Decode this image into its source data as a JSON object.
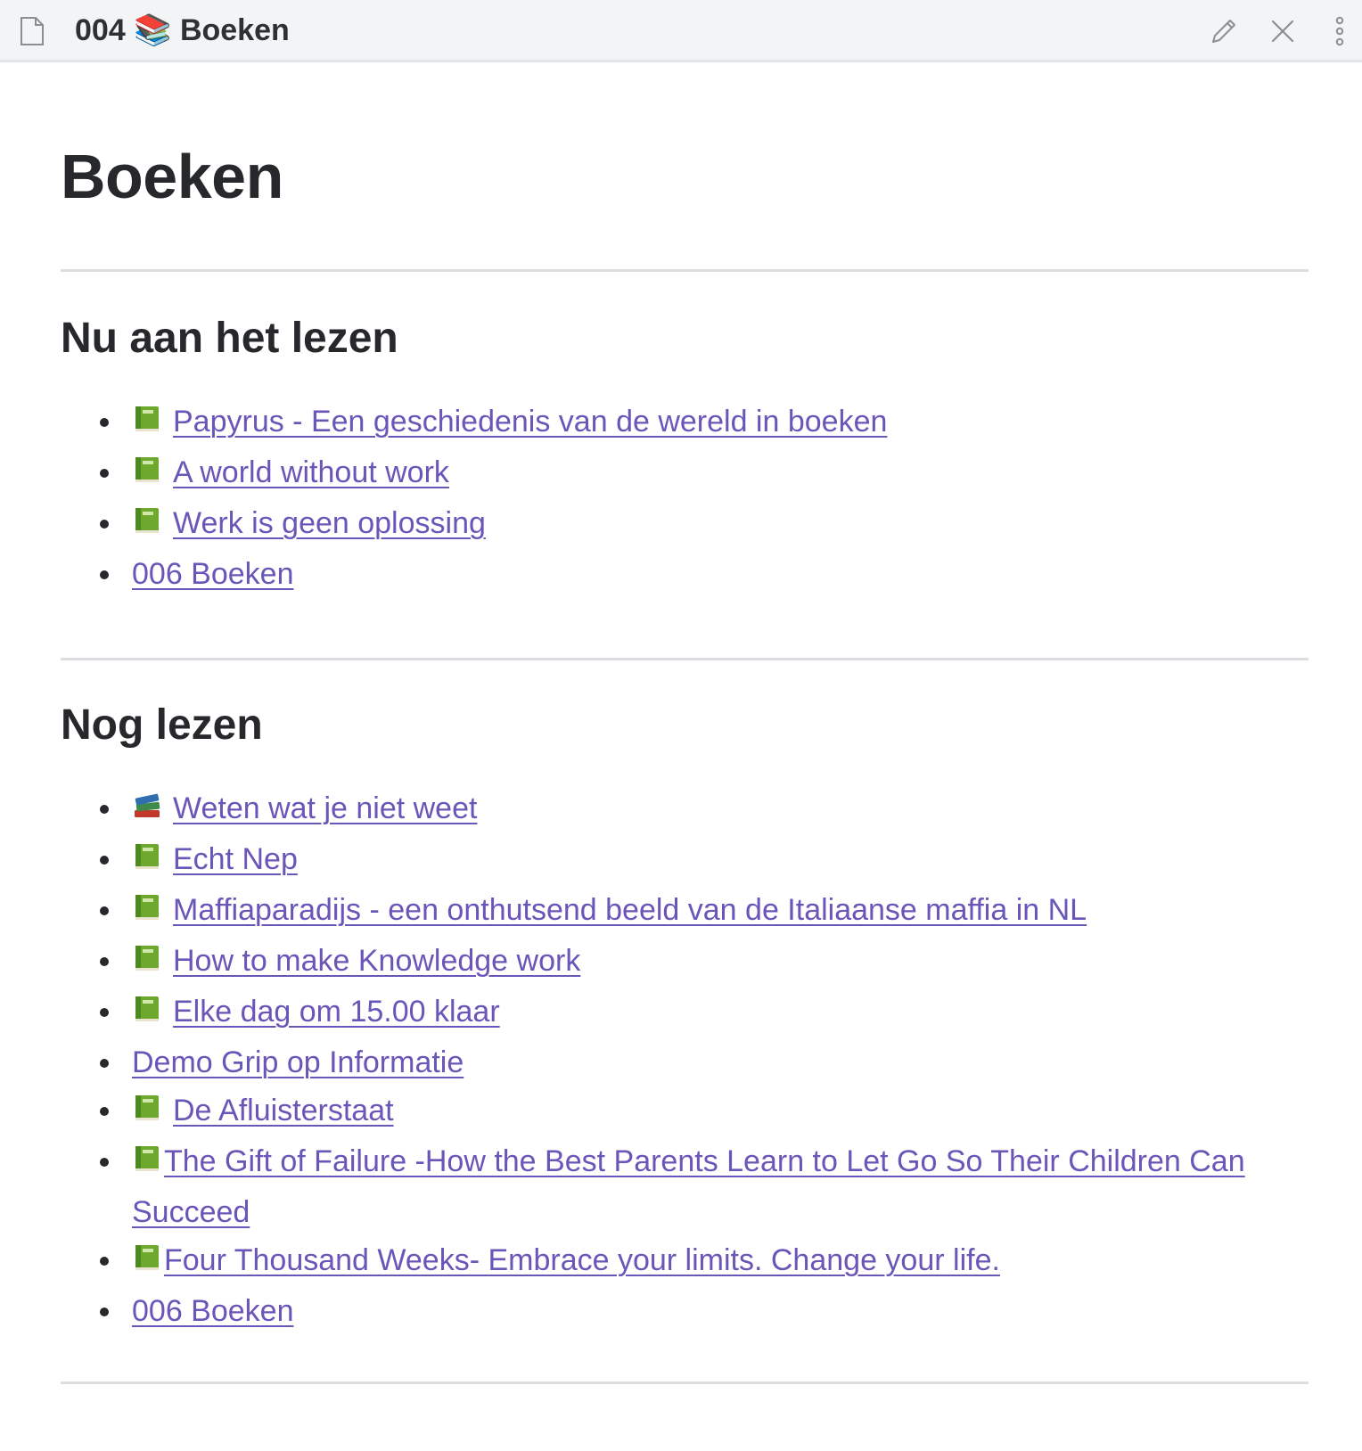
{
  "header": {
    "title": "004 📚 Boeken",
    "icons": [
      "file-icon",
      "edit-pencil-icon",
      "close-icon",
      "more-options-icon"
    ]
  },
  "page": {
    "title": "Boeken"
  },
  "sections": [
    {
      "heading": "Nu aan het lezen",
      "items": [
        {
          "emoji": "green-book",
          "label": "Papyrus - Een geschiedenis van de wereld in boeken"
        },
        {
          "emoji": "green-book",
          "label": "A world without work"
        },
        {
          "emoji": "green-book",
          "label": "Werk is geen oplossing"
        },
        {
          "emoji": "",
          "label": "006 Boeken"
        }
      ]
    },
    {
      "heading": "Nog lezen",
      "items": [
        {
          "emoji": "books-stack",
          "label": "Weten wat je niet weet"
        },
        {
          "emoji": "green-book",
          "label": "Echt Nep"
        },
        {
          "emoji": "green-book",
          "label": "Maffiaparadijs - een onthutsend beeld van de Italiaanse maffia in NL"
        },
        {
          "emoji": "green-book",
          "label": "How to make Knowledge work"
        },
        {
          "emoji": "green-book",
          "label": "Elke dag om 15.00 klaar"
        },
        {
          "emoji": "",
          "label": "Demo Grip op Informatie"
        },
        {
          "emoji": "green-book",
          "label": "De Afluisterstaat"
        },
        {
          "emoji": "green-book-tight",
          "label": "The Gift of Failure -How the Best Parents Learn to Let Go So Their Children Can Succeed"
        },
        {
          "emoji": "green-book-tight",
          "label": "Four Thousand Weeks- Embrace your limits. Change your life."
        },
        {
          "emoji": "",
          "label": "006 Boeken"
        }
      ]
    }
  ],
  "colors": {
    "link": "#6a55b8",
    "heading": "#26282b",
    "header_bg": "#f3f4f6",
    "rule": "#dcdde0"
  }
}
